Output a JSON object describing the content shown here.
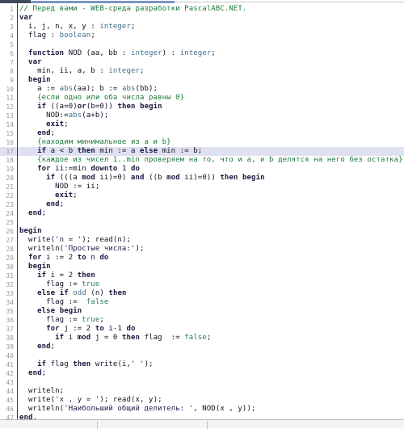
{
  "app": {
    "name": "PascalABC.NET WEB IDE",
    "language": "pascal"
  },
  "editor": {
    "highlighted_line": 17,
    "first_line": 1,
    "last_line": 47,
    "colors": {
      "background": "#ffffff",
      "gutter_text": "#9a9a9a",
      "gutter_rule": "#3a3a3a",
      "highlight": "#dfe0f2",
      "comment": "#1f7a3d",
      "keyword": "#19193f",
      "type": "#3f6f8f",
      "string": "#21214a",
      "boolean": "#2e7d5b",
      "plain": "#111122",
      "tab_stub": "#3f4b5b",
      "tab_rail": "#7b96c4",
      "statusbar": "#f4f4f4"
    },
    "lines": [
      {
        "n": "1",
        "tokens": [
          {
            "t": "// Перед вами - WEB-среда разработки PascalABC.NET.",
            "c": "t-cm"
          }
        ]
      },
      {
        "n": "2",
        "tokens": [
          {
            "t": "var",
            "c": "t-kw"
          }
        ]
      },
      {
        "n": "3",
        "tokens": [
          {
            "t": "  i, j, n, x, y : ",
            "c": "t-pl"
          },
          {
            "t": "integer",
            "c": "t-ty"
          },
          {
            "t": ";",
            "c": "t-pl"
          }
        ]
      },
      {
        "n": "4",
        "tokens": [
          {
            "t": "  flag : ",
            "c": "t-pl"
          },
          {
            "t": "boolean",
            "c": "t-ty"
          },
          {
            "t": ";",
            "c": "t-pl"
          }
        ]
      },
      {
        "n": "5",
        "tokens": [
          {
            "t": "",
            "c": "t-pl"
          }
        ]
      },
      {
        "n": "6",
        "tokens": [
          {
            "t": "  ",
            "c": "t-pl"
          },
          {
            "t": "function",
            "c": "t-kw"
          },
          {
            "t": " NOD (aa, bb : ",
            "c": "t-pl"
          },
          {
            "t": "integer",
            "c": "t-ty"
          },
          {
            "t": ") : ",
            "c": "t-pl"
          },
          {
            "t": "integer",
            "c": "t-ty"
          },
          {
            "t": ";",
            "c": "t-pl"
          }
        ]
      },
      {
        "n": "7",
        "tokens": [
          {
            "t": "  ",
            "c": "t-pl"
          },
          {
            "t": "var",
            "c": "t-kw"
          }
        ]
      },
      {
        "n": "8",
        "tokens": [
          {
            "t": "    min, ii, a, b : ",
            "c": "t-pl"
          },
          {
            "t": "integer",
            "c": "t-ty"
          },
          {
            "t": ";",
            "c": "t-pl"
          }
        ]
      },
      {
        "n": "9",
        "tokens": [
          {
            "t": "  ",
            "c": "t-pl"
          },
          {
            "t": "begin",
            "c": "t-kw"
          }
        ]
      },
      {
        "n": "10",
        "tokens": [
          {
            "t": "    a := ",
            "c": "t-pl"
          },
          {
            "t": "abs",
            "c": "t-ty"
          },
          {
            "t": "(aa); b := ",
            "c": "t-pl"
          },
          {
            "t": "abs",
            "c": "t-ty"
          },
          {
            "t": "(bb);",
            "c": "t-pl"
          }
        ]
      },
      {
        "n": "11",
        "tokens": [
          {
            "t": "    {если одно или оба числа равны 0}",
            "c": "t-cm"
          }
        ]
      },
      {
        "n": "12",
        "tokens": [
          {
            "t": "    ",
            "c": "t-pl"
          },
          {
            "t": "if",
            "c": "t-kw"
          },
          {
            "t": " ((a=0)",
            "c": "t-pl"
          },
          {
            "t": "or",
            "c": "t-kw"
          },
          {
            "t": "(b=0)) ",
            "c": "t-pl"
          },
          {
            "t": "then",
            "c": "t-kw"
          },
          {
            "t": " ",
            "c": "t-pl"
          },
          {
            "t": "begin",
            "c": "t-kw"
          }
        ]
      },
      {
        "n": "13",
        "tokens": [
          {
            "t": "      NOD:=",
            "c": "t-pl"
          },
          {
            "t": "abs",
            "c": "t-ty"
          },
          {
            "t": "(a+b);",
            "c": "t-pl"
          }
        ]
      },
      {
        "n": "14",
        "tokens": [
          {
            "t": "      ",
            "c": "t-pl"
          },
          {
            "t": "exit",
            "c": "t-kw"
          },
          {
            "t": ";",
            "c": "t-pl"
          }
        ]
      },
      {
        "n": "15",
        "tokens": [
          {
            "t": "    ",
            "c": "t-pl"
          },
          {
            "t": "end",
            "c": "t-kw"
          },
          {
            "t": ";",
            "c": "t-pl"
          }
        ]
      },
      {
        "n": "16",
        "tokens": [
          {
            "t": "    {находим минимальное из a и b}",
            "c": "t-cm"
          }
        ]
      },
      {
        "n": "17",
        "tokens": [
          {
            "t": "    ",
            "c": "t-pl"
          },
          {
            "t": "if",
            "c": "t-kw"
          },
          {
            "t": " a < b ",
            "c": "t-pl"
          },
          {
            "t": "then",
            "c": "t-kw"
          },
          {
            "t": " min := a ",
            "c": "t-pl"
          },
          {
            "t": "else",
            "c": "t-kw"
          },
          {
            "t": " min := b;",
            "c": "t-pl"
          }
        ]
      },
      {
        "n": "18",
        "tokens": [
          {
            "t": "    {каждое из чисел 1..min проверяем на то, что и a, и b делятся на него без остатка}",
            "c": "t-cm"
          }
        ]
      },
      {
        "n": "19",
        "tokens": [
          {
            "t": "    ",
            "c": "t-pl"
          },
          {
            "t": "for",
            "c": "t-kw"
          },
          {
            "t": " ii:=min ",
            "c": "t-pl"
          },
          {
            "t": "downto",
            "c": "t-kw"
          },
          {
            "t": " 1 ",
            "c": "t-pl"
          },
          {
            "t": "do",
            "c": "t-kw"
          }
        ]
      },
      {
        "n": "20",
        "tokens": [
          {
            "t": "      ",
            "c": "t-pl"
          },
          {
            "t": "if",
            "c": "t-kw"
          },
          {
            "t": " (((a ",
            "c": "t-pl"
          },
          {
            "t": "mod",
            "c": "t-kw"
          },
          {
            "t": " ii)=0) ",
            "c": "t-pl"
          },
          {
            "t": "and",
            "c": "t-kw"
          },
          {
            "t": " ((b ",
            "c": "t-pl"
          },
          {
            "t": "mod",
            "c": "t-kw"
          },
          {
            "t": " ii)=0)) ",
            "c": "t-pl"
          },
          {
            "t": "then",
            "c": "t-kw"
          },
          {
            "t": " ",
            "c": "t-pl"
          },
          {
            "t": "begin",
            "c": "t-kw"
          }
        ]
      },
      {
        "n": "21",
        "tokens": [
          {
            "t": "        NOD := ii;",
            "c": "t-pl"
          }
        ]
      },
      {
        "n": "22",
        "tokens": [
          {
            "t": "        ",
            "c": "t-pl"
          },
          {
            "t": "exit",
            "c": "t-kw"
          },
          {
            "t": ";",
            "c": "t-pl"
          }
        ]
      },
      {
        "n": "23",
        "tokens": [
          {
            "t": "      ",
            "c": "t-pl"
          },
          {
            "t": "end",
            "c": "t-kw"
          },
          {
            "t": ";",
            "c": "t-pl"
          }
        ]
      },
      {
        "n": "24",
        "tokens": [
          {
            "t": "  ",
            "c": "t-pl"
          },
          {
            "t": "end",
            "c": "t-kw"
          },
          {
            "t": ";",
            "c": "t-pl"
          }
        ]
      },
      {
        "n": "25",
        "tokens": [
          {
            "t": "",
            "c": "t-pl"
          }
        ]
      },
      {
        "n": "26",
        "tokens": [
          {
            "t": "begin",
            "c": "t-kw"
          }
        ]
      },
      {
        "n": "27",
        "tokens": [
          {
            "t": "  write(",
            "c": "t-pl"
          },
          {
            "t": "'n = '",
            "c": "t-st"
          },
          {
            "t": "); read(n);",
            "c": "t-pl"
          }
        ]
      },
      {
        "n": "28",
        "tokens": [
          {
            "t": "  writeln(",
            "c": "t-pl"
          },
          {
            "t": "'Простые числа:'",
            "c": "t-st"
          },
          {
            "t": ");",
            "c": "t-pl"
          }
        ]
      },
      {
        "n": "29",
        "tokens": [
          {
            "t": "  ",
            "c": "t-pl"
          },
          {
            "t": "for",
            "c": "t-kw"
          },
          {
            "t": " i := 2 ",
            "c": "t-pl"
          },
          {
            "t": "to",
            "c": "t-kw"
          },
          {
            "t": " n ",
            "c": "t-pl"
          },
          {
            "t": "do",
            "c": "t-kw"
          }
        ]
      },
      {
        "n": "30",
        "tokens": [
          {
            "t": "  ",
            "c": "t-pl"
          },
          {
            "t": "begin",
            "c": "t-kw"
          }
        ]
      },
      {
        "n": "31",
        "tokens": [
          {
            "t": "    ",
            "c": "t-pl"
          },
          {
            "t": "if",
            "c": "t-kw"
          },
          {
            "t": " i = 2 ",
            "c": "t-pl"
          },
          {
            "t": "then",
            "c": "t-kw"
          }
        ]
      },
      {
        "n": "32",
        "tokens": [
          {
            "t": "      flag := ",
            "c": "t-pl"
          },
          {
            "t": "true",
            "c": "t-bl"
          }
        ]
      },
      {
        "n": "33",
        "tokens": [
          {
            "t": "    ",
            "c": "t-pl"
          },
          {
            "t": "else",
            "c": "t-kw"
          },
          {
            "t": " ",
            "c": "t-pl"
          },
          {
            "t": "if",
            "c": "t-kw"
          },
          {
            "t": " ",
            "c": "t-pl"
          },
          {
            "t": "odd",
            "c": "t-ty"
          },
          {
            "t": " (n) ",
            "c": "t-pl"
          },
          {
            "t": "then",
            "c": "t-kw"
          }
        ]
      },
      {
        "n": "34",
        "tokens": [
          {
            "t": "      flag :=  ",
            "c": "t-pl"
          },
          {
            "t": "false",
            "c": "t-bl"
          }
        ]
      },
      {
        "n": "35",
        "tokens": [
          {
            "t": "    ",
            "c": "t-pl"
          },
          {
            "t": "else",
            "c": "t-kw"
          },
          {
            "t": " ",
            "c": "t-pl"
          },
          {
            "t": "begin",
            "c": "t-kw"
          }
        ]
      },
      {
        "n": "36",
        "tokens": [
          {
            "t": "      flag := ",
            "c": "t-pl"
          },
          {
            "t": "true",
            "c": "t-bl"
          },
          {
            "t": ";",
            "c": "t-pl"
          }
        ]
      },
      {
        "n": "37",
        "tokens": [
          {
            "t": "      ",
            "c": "t-pl"
          },
          {
            "t": "for",
            "c": "t-kw"
          },
          {
            "t": " j := 2 ",
            "c": "t-pl"
          },
          {
            "t": "to",
            "c": "t-kw"
          },
          {
            "t": " i-1 ",
            "c": "t-pl"
          },
          {
            "t": "do",
            "c": "t-kw"
          }
        ]
      },
      {
        "n": "38",
        "tokens": [
          {
            "t": "        ",
            "c": "t-pl"
          },
          {
            "t": "if",
            "c": "t-kw"
          },
          {
            "t": " i ",
            "c": "t-pl"
          },
          {
            "t": "mod",
            "c": "t-kw"
          },
          {
            "t": " j = 0 ",
            "c": "t-pl"
          },
          {
            "t": "then",
            "c": "t-kw"
          },
          {
            "t": " flag  := ",
            "c": "t-pl"
          },
          {
            "t": "false",
            "c": "t-bl"
          },
          {
            "t": ";",
            "c": "t-pl"
          }
        ]
      },
      {
        "n": "39",
        "tokens": [
          {
            "t": "    ",
            "c": "t-pl"
          },
          {
            "t": "end",
            "c": "t-kw"
          },
          {
            "t": ";",
            "c": "t-pl"
          }
        ]
      },
      {
        "n": "40",
        "tokens": [
          {
            "t": "",
            "c": "t-pl"
          }
        ]
      },
      {
        "n": "41",
        "tokens": [
          {
            "t": "    ",
            "c": "t-pl"
          },
          {
            "t": "if",
            "c": "t-kw"
          },
          {
            "t": " flag ",
            "c": "t-pl"
          },
          {
            "t": "then",
            "c": "t-kw"
          },
          {
            "t": " write(i,",
            "c": "t-pl"
          },
          {
            "t": "' '",
            "c": "t-st"
          },
          {
            "t": ");",
            "c": "t-pl"
          }
        ]
      },
      {
        "n": "42",
        "tokens": [
          {
            "t": "  ",
            "c": "t-pl"
          },
          {
            "t": "end",
            "c": "t-kw"
          },
          {
            "t": ";",
            "c": "t-pl"
          }
        ]
      },
      {
        "n": "43",
        "tokens": [
          {
            "t": "",
            "c": "t-pl"
          }
        ]
      },
      {
        "n": "44",
        "tokens": [
          {
            "t": "  writeln;",
            "c": "t-pl"
          }
        ]
      },
      {
        "n": "45",
        "tokens": [
          {
            "t": "  write(",
            "c": "t-pl"
          },
          {
            "t": "'x , y = '",
            "c": "t-st"
          },
          {
            "t": "); read(x, y);",
            "c": "t-pl"
          }
        ]
      },
      {
        "n": "46",
        "tokens": [
          {
            "t": "  writeln(",
            "c": "t-pl"
          },
          {
            "t": "'Наибольший общий делитель: '",
            "c": "t-st"
          },
          {
            "t": ", NOD(x , y));",
            "c": "t-pl"
          }
        ]
      },
      {
        "n": "47",
        "tokens": [
          {
            "t": "end",
            "c": "t-kw"
          },
          {
            "t": ".",
            "c": "t-pl"
          }
        ]
      }
    ]
  },
  "statusbar": {
    "segments": [
      "",
      "",
      ""
    ]
  }
}
